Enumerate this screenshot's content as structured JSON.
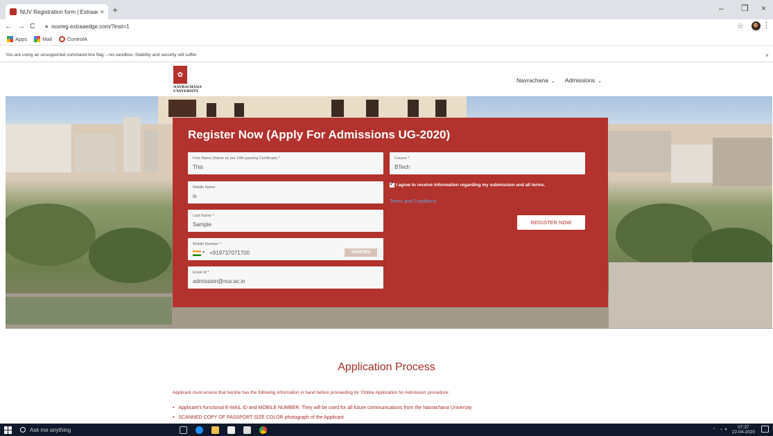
{
  "browser": {
    "tab_title": "NUV Registration form | Extraaed",
    "tab_close": "×",
    "new_tab": "+",
    "url": "nuvreg.extraaedge.com/?inst=1",
    "window_controls": {
      "minimize": "–",
      "restore": "❐",
      "close": "×"
    },
    "bookmarks": [
      "Apps",
      "Mail",
      "ControlA"
    ],
    "infobar_text": "You are using an unsupported command-line flag: --no-sandbox. Stability and security will suffer.",
    "infobar_close": "×"
  },
  "header": {
    "logo_text": "NAVRACHANA UNIVERSITY",
    "nav": [
      {
        "label": "Navrachana"
      },
      {
        "label": "Admissions"
      }
    ]
  },
  "form": {
    "title": "Register Now (Apply For Admissions UG-2020)",
    "fields": {
      "first_name": {
        "label": "First Name (Name as per 10th passing Certificate)",
        "value": "This"
      },
      "middle_name": {
        "label": "Middle Name",
        "value": "is"
      },
      "last_name": {
        "label": "Last Name",
        "value": "Sample"
      },
      "mobile": {
        "label": "Mobile Number",
        "value": "+919737071700",
        "verified": "VERIFIED"
      },
      "email": {
        "label": "Email Id",
        "value": "admission@nuv.ac.in"
      },
      "course": {
        "label": "Course",
        "value": "BTech"
      }
    },
    "required_mark": "*",
    "agree_text": "I agree to receive information regarding my submission and all terms.",
    "agree_checked": true,
    "terms_link": "Terms and Conditions",
    "register_button": "REGISTER NOW"
  },
  "process": {
    "title": "Application Process",
    "intro": "Applicant must ensure that he/she has the following information in hand before proceeding for 'Online Application for Admission' procedure:",
    "items": [
      "Applicant's functional E-MAIL ID and MOBILE NUMBER. They will be used for all future communications from the Navrachana University",
      "SCANNED COPY OF PASSPORT SIZE COLOR photograph of the Applicant"
    ]
  },
  "taskbar": {
    "search_placeholder": "Ask me anything",
    "time": "07:37",
    "date": "22-04-2020"
  },
  "colors": {
    "brand_red": "#b2322d",
    "link_blue": "#6aa3d8",
    "taskbar": "#10192b"
  }
}
